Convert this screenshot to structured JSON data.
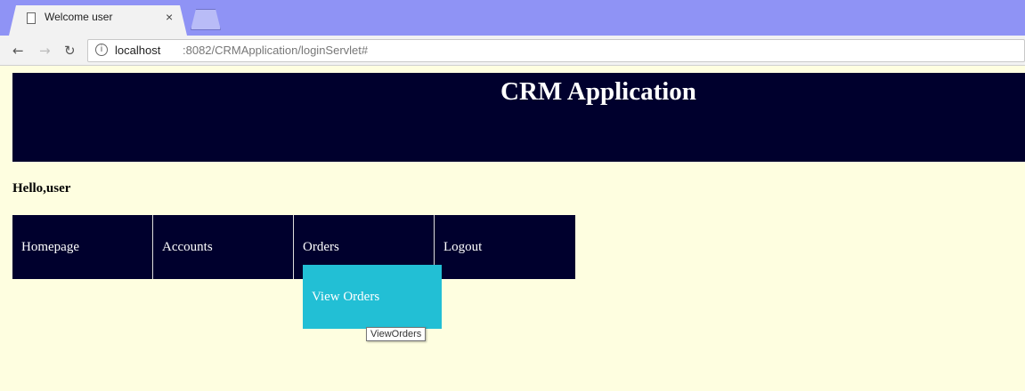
{
  "browser": {
    "tab_title": "Welcome user",
    "tab_close": "×",
    "url_host": "localhost",
    "url_rest": ":8082/CRMApplication/loginServlet#",
    "info_icon": "i"
  },
  "header": {
    "title": "CRM Application"
  },
  "greeting": "Hello,user",
  "nav": {
    "items": [
      {
        "label": "Homepage"
      },
      {
        "label": "Accounts"
      },
      {
        "label": "Orders"
      },
      {
        "label": "Logout"
      }
    ]
  },
  "dropdown": {
    "item_label": "View Orders",
    "tooltip": "ViewOrders"
  },
  "colors": {
    "header_bg": "#00002d",
    "page_bg": "#fefee0",
    "dropdown_bg": "#22bfd5",
    "tabstrip_bg": "#8f93f5"
  }
}
